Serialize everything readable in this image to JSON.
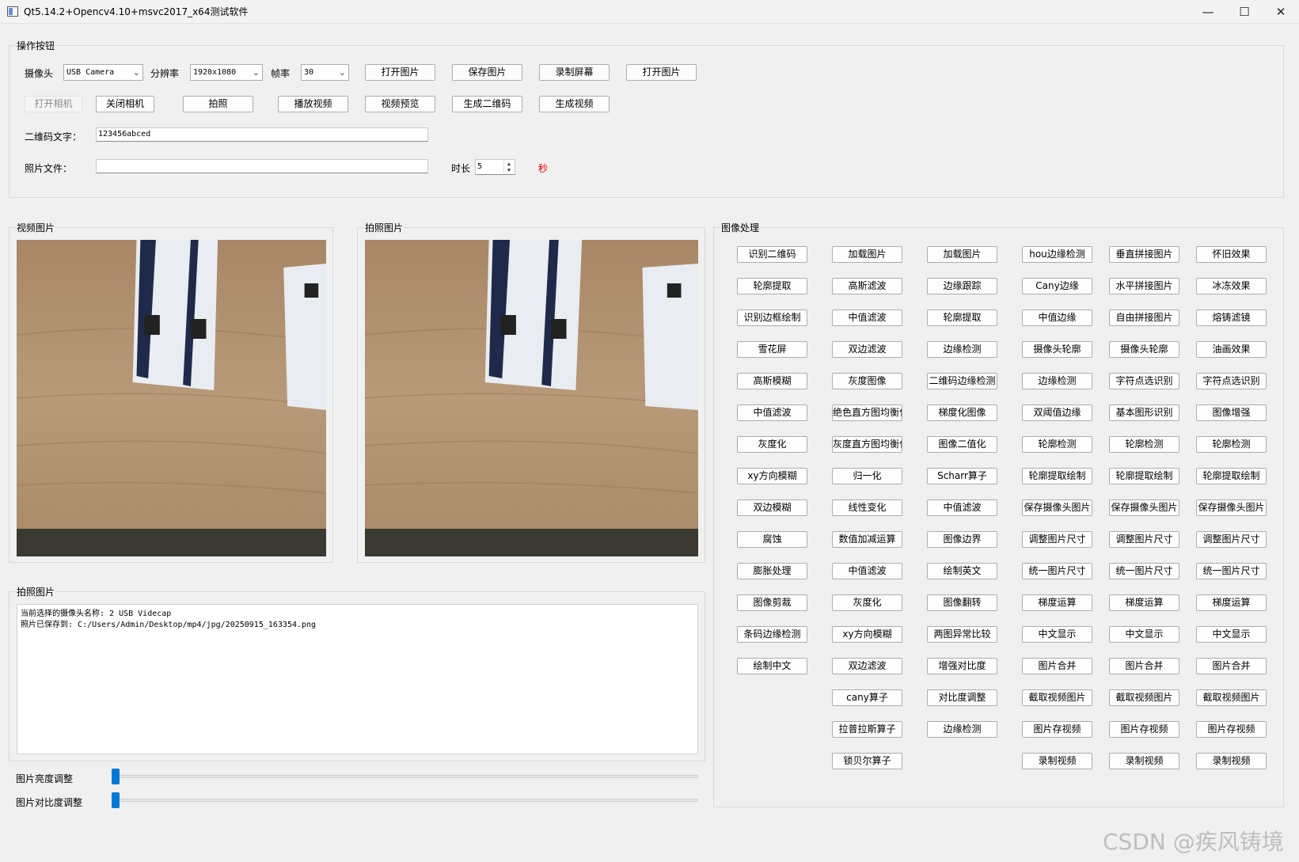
{
  "window": {
    "title": "Qt5.14.2+Opencv4.10+msvc2017_x64测试软件",
    "minimize": "—",
    "maximize": "☐",
    "close": "✕"
  },
  "controls": {
    "group_title": "操作按钮",
    "camera_label": "摄像头",
    "camera_value": "USB Camera",
    "resolution_label": "分辨率",
    "resolution_value": "1920x1080",
    "fps_label": "帧率",
    "fps_value": "30",
    "row1_buttons": [
      "打开图片",
      "保存图片",
      "录制屏幕",
      "打开图片"
    ],
    "open_camera": "打开相机",
    "close_camera": "关闭相机",
    "row2_buttons": [
      "拍照",
      "播放视频",
      "视频预览",
      "生成二维码",
      "生成视频"
    ],
    "qr_label": "二维码文字：",
    "qr_value": "123456abced",
    "photo_label": "照片文件：",
    "photo_value": "",
    "duration_label": "时长",
    "duration_value": "5",
    "seconds_label": "秒"
  },
  "video_panel": {
    "title": "视频图片"
  },
  "photo_panel": {
    "title": "拍照图片"
  },
  "log_panel": {
    "title": "拍照图片",
    "lines": [
      "当前选择的摄像头名称: 2 USB Videcap",
      "照片已保存到: C:/Users/Admin/Desktop/mp4/jpg/20250915_163354.png"
    ]
  },
  "sliders": {
    "brightness_label": "图片亮度调整",
    "brightness_value": 0,
    "contrast_label": "图片对比度调整",
    "contrast_value": 0
  },
  "processing": {
    "title": "图像处理",
    "columns": [
      [
        "识别二维码",
        "轮廓提取",
        "识别边框绘制",
        "雪花屏",
        "高斯模糊",
        "中值滤波",
        "灰度化",
        "xy方向模糊",
        "双边模糊",
        "腐蚀",
        "膨胀处理",
        "图像剪裁",
        "条码边缘检测",
        "绘制中文"
      ],
      [
        "加载图片",
        "高斯滤波",
        "中值滤波",
        "双边滤波",
        "灰度图像",
        "绝色直方图均衡化",
        "灰度直方图均衡化",
        "归一化",
        "线性变化",
        "数值加减运算",
        "中值滤波",
        "灰度化",
        "xy方向模糊",
        "双边滤波",
        "cany算子",
        "拉普拉斯算子",
        "锁贝尔算子"
      ],
      [
        "加载图片",
        "边缘跟踪",
        "轮廓提取",
        "边缘检测",
        "二维码边缘检测",
        "梯度化图像",
        "图像二值化",
        "Scharr算子",
        "中值滤波",
        "图像边界",
        "绘制英文",
        "图像翻转",
        "两图异常比较",
        "增强对比度",
        "对比度调整",
        "边缘检测"
      ],
      [
        "hou边缘检测",
        "Cany边缘",
        "中值边缘",
        "摄像头轮廓",
        "边缘检测",
        "双阈值边缘",
        "轮廓检测",
        "轮廓提取绘制",
        "保存摄像头图片",
        "调整图片尺寸",
        "统一图片尺寸",
        "梯度运算",
        "中文显示",
        "图片合并",
        "截取视频图片",
        "图片存视频",
        "录制视频"
      ],
      [
        "垂直拼接图片",
        "水平拼接图片",
        "自由拼接图片",
        "摄像头轮廓",
        "字符点选识别",
        "基本图形识别",
        "轮廓检测",
        "轮廓提取绘制",
        "保存摄像头图片",
        "调整图片尺寸",
        "统一图片尺寸",
        "梯度运算",
        "中文显示",
        "图片合并",
        "截取视频图片",
        "图片存视频",
        "录制视频"
      ],
      [
        "怀旧效果",
        "冰冻效果",
        "熔铸滤镜",
        "油画效果",
        "字符点选识别",
        "图像增强",
        "轮廓检测",
        "轮廓提取绘制",
        "保存摄像头图片",
        "调整图片尺寸",
        "统一图片尺寸",
        "梯度运算",
        "中文显示",
        "图片合并",
        "截取视频图片",
        "图片存视频",
        "录制视频"
      ]
    ]
  },
  "watermark": "CSDN @疾风铸境"
}
